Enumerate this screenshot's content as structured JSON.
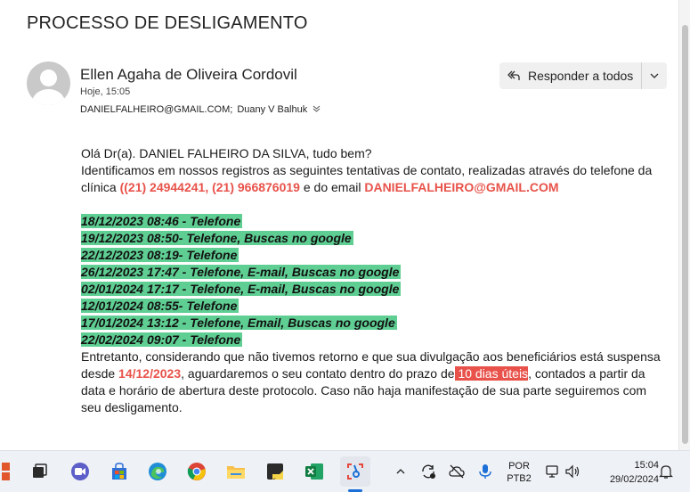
{
  "email": {
    "subject": "PROCESSO DE DESLIGAMENTO",
    "sender_name": "Ellen Agaha de Oliveira Cordovil",
    "date": "Hoje, 15:05",
    "recipient_1": "DANIELFALHEIRO@GMAIL.COM;",
    "recipient_2": "Duany V Balhuk",
    "reply_all_label": "Responder a todos"
  },
  "body": {
    "greeting": "Olá Dr(a). DANIEL FALHEIRO DA SILVA, tudo bem?",
    "intro_1": "Identificamos em nossos registros as seguintes tentativas de contato, realizadas através do telefone da clínica ",
    "phones": "((21) 24944241, (21) 966876019",
    "intro_2": " e do email ",
    "email": "DANIELFALHEIRO@GMAIL.COM",
    "records": [
      "18/12/2023 08:46 - Telefone",
      "19/12/2023 08:50-  Telefone, Buscas no google",
      "22/12/2023 08:19- Telefone",
      "26/12/2023 17:47 -  Telefone, E-mail, Buscas no google",
      "02/01/2024 17:17 - Telefone, E-mail, Buscas no google",
      "12/01/2024 08:55- Telefone",
      "17/01/2024 13:12 - Telefone, Email, Buscas no google ",
      "22/02/2024 09:07 - Telefone"
    ],
    "p2_a": "Entretanto, considerando que não tivemos retorno e que sua divulgação aos beneficiários está suspensa desde ",
    "p2_date": "14/12/2023",
    "p2_b": ", aguardaremos o seu contato dentro do prazo de",
    "p2_deadline": " 10 dias úteis",
    "p2_c": ", contados a partir da data e horário de abertura deste protocolo. Caso não haja manifestação de sua parte seguiremos com seu desligamento."
  },
  "taskbar": {
    "lang_1": "POR",
    "lang_2": "PTB2",
    "time": "15:04",
    "date": "29/02/2024",
    "icons": [
      "start-icon",
      "task-view-icon",
      "meet-icon",
      "store-icon",
      "edge-icon",
      "chrome-icon",
      "file-explorer-icon",
      "sticky-notes-icon",
      "excel-icon",
      "snipping-tool-icon"
    ]
  },
  "colors": {
    "highlight_green": "#5fce93",
    "accent_red": "#e8524a"
  }
}
